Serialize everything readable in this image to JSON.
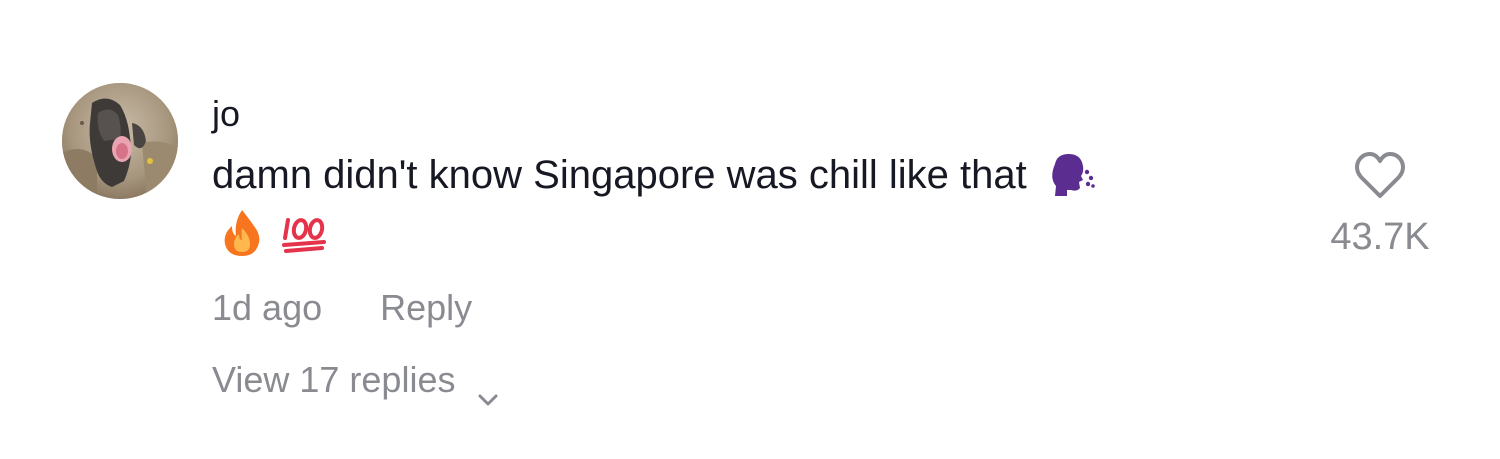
{
  "comment": {
    "username": "jo",
    "text": "damn didn't know Singapore was chill like that",
    "inline_emoji": "speaking-head-icon",
    "reaction_emojis": [
      "fire-icon",
      "hundred-points-icon"
    ],
    "timestamp": "1d ago",
    "reply_label": "Reply",
    "view_replies_label": "View 17 replies",
    "like_count": "43.7K"
  },
  "colors": {
    "primary_text": "#161823",
    "secondary_text": "#8a8b91",
    "speaking_head": "#6b3fa0",
    "heart_outline": "#8a8b91"
  }
}
